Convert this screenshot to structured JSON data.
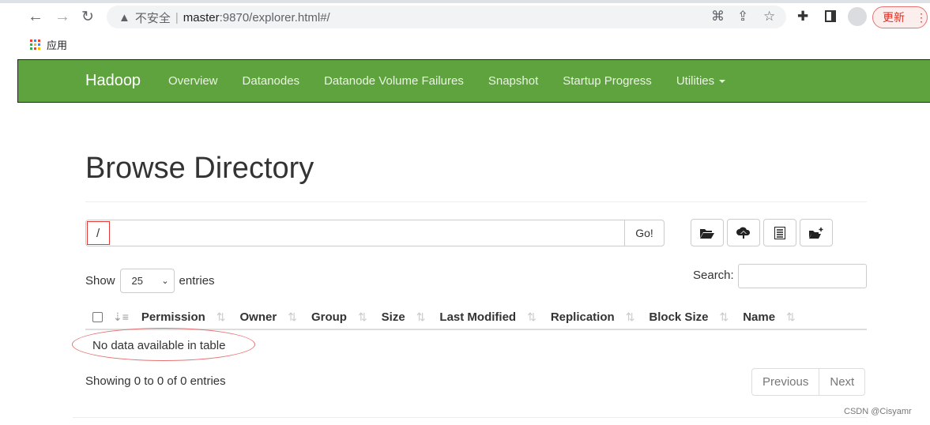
{
  "browser": {
    "insecure_label": "不安全",
    "url_host": "master",
    "url_rest": ":9870/explorer.html#/",
    "bookmark_apps": "应用",
    "update_label": "更新"
  },
  "navbar": {
    "brand": "Hadoop",
    "links": [
      "Overview",
      "Datanodes",
      "Datanode Volume Failures",
      "Snapshot",
      "Startup Progress",
      "Utilities"
    ],
    "color": "#5fa33e"
  },
  "page": {
    "title": "Browse Directory",
    "path_value": "/",
    "go_label": "Go!",
    "icon_buttons": [
      "folder-open-icon",
      "cloud-upload-icon",
      "list-alt-icon",
      "create-folder-icon"
    ],
    "show_label": "Show",
    "entries_select": "25",
    "entries_label": "entries",
    "search_label": "Search:",
    "columns": [
      "Permission",
      "Owner",
      "Group",
      "Size",
      "Last Modified",
      "Replication",
      "Block Size",
      "Name"
    ],
    "empty_message": "No data available in table",
    "showing": "Showing 0 to 0 of 0 entries",
    "previous": "Previous",
    "next": "Next"
  },
  "watermark": "CSDN @Cisyamr"
}
